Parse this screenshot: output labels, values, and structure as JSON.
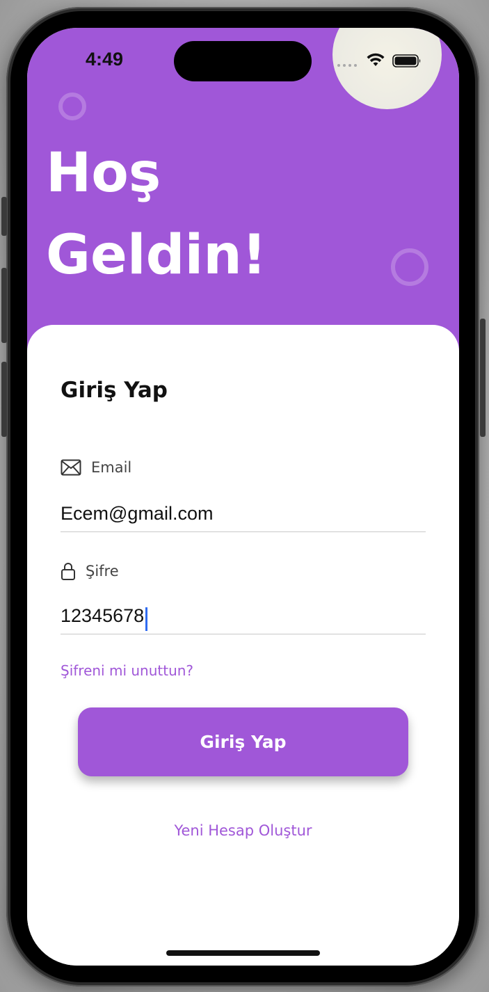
{
  "status_bar": {
    "time": "4:49",
    "icons": [
      "cellular-signal-icon",
      "wifi-icon",
      "battery-icon"
    ]
  },
  "header": {
    "title_line1": "Hoş",
    "title_line2": "Geldin!"
  },
  "login_card": {
    "title": "Giriş Yap",
    "email": {
      "icon": "envelope-icon",
      "label": "Email",
      "value": "Ecem@gmail.com"
    },
    "password": {
      "icon": "lock-icon",
      "label": "Şifre",
      "value": "12345678"
    },
    "forgot_link": "Şifreni mi unuttun?",
    "login_button": "Giriş Yap",
    "create_account_link": "Yeni Hesap Oluştur"
  },
  "colors": {
    "accent": "#a057d8",
    "text": "#111111",
    "caret": "#2f6bf0"
  }
}
